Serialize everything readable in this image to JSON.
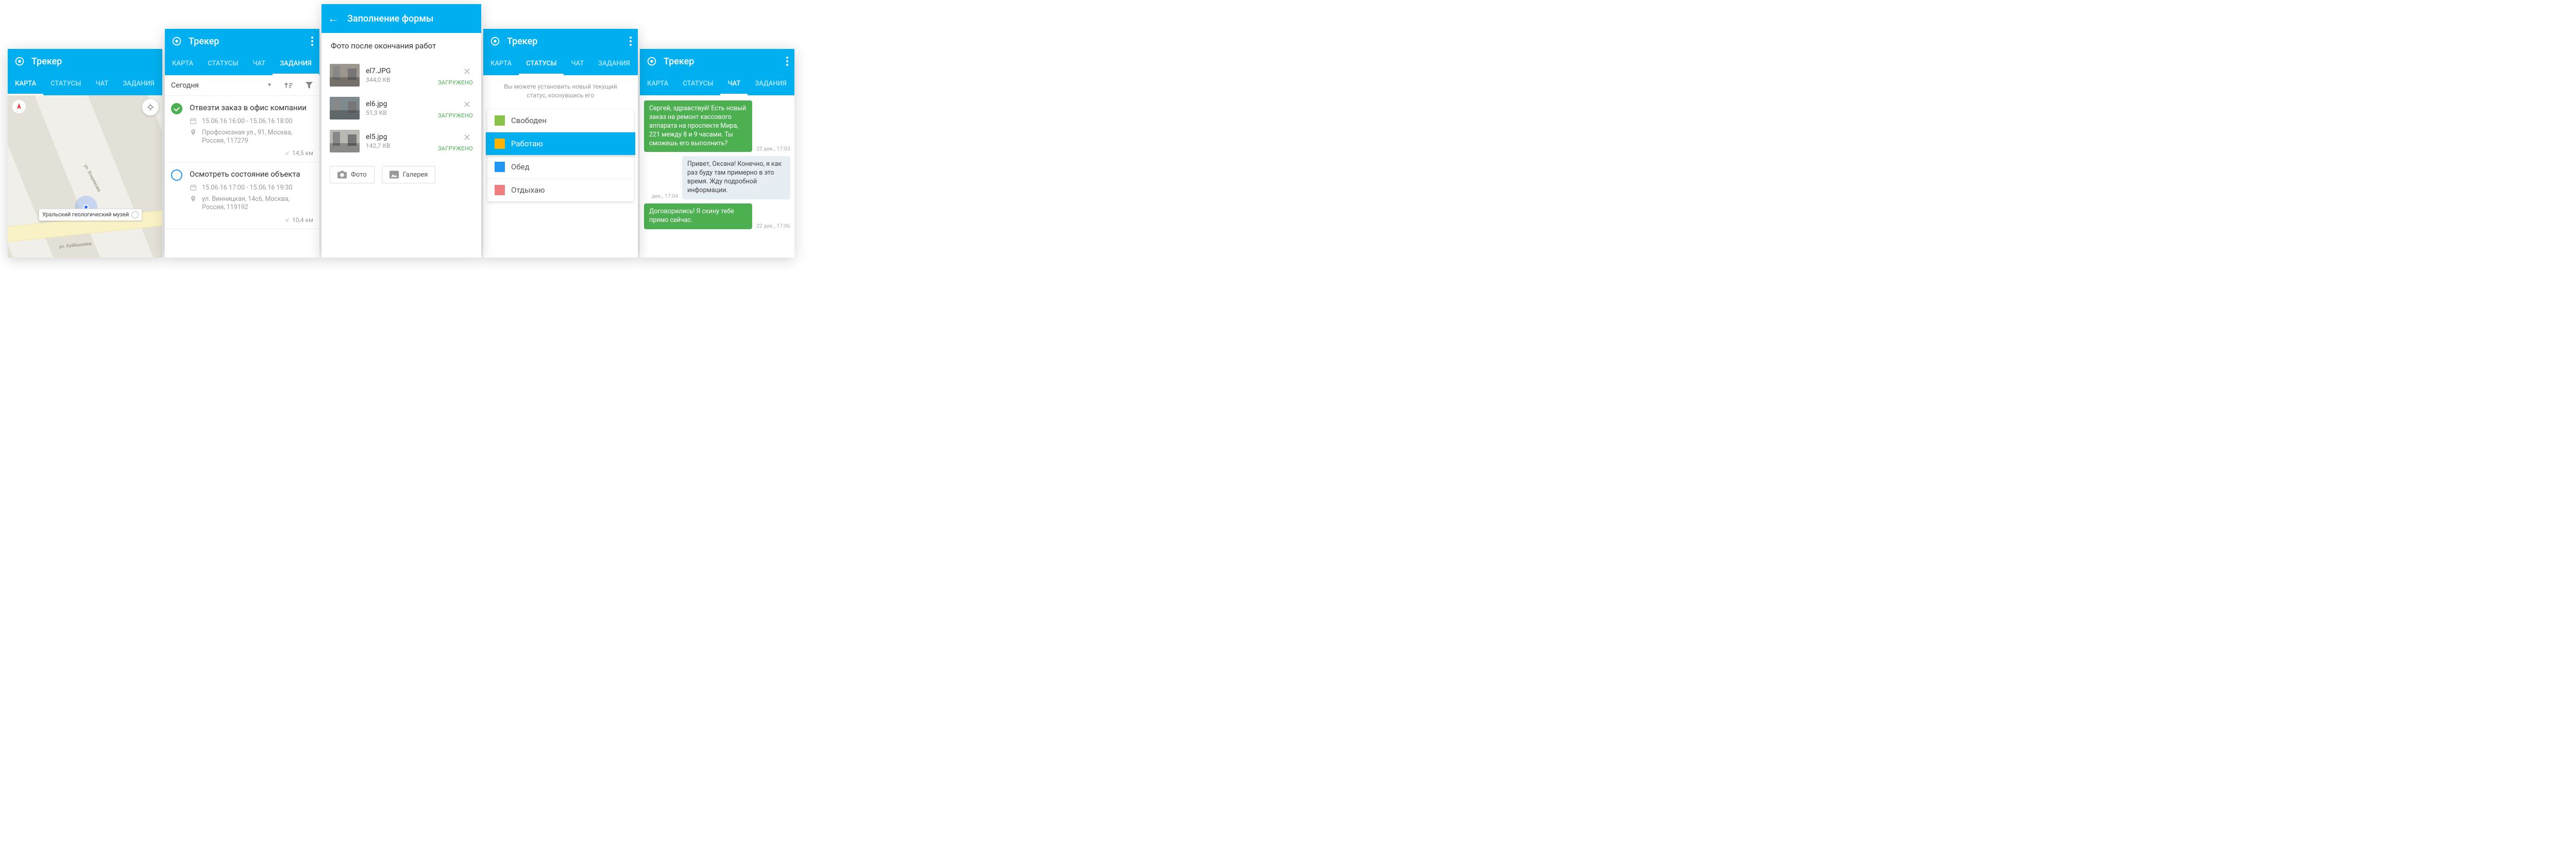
{
  "app": {
    "title": "Трекер"
  },
  "tabs": {
    "map": "КАРТА",
    "statuses": "СТАТУСЫ",
    "chat": "ЧАТ",
    "tasks": "ЗАДАНИЯ"
  },
  "map": {
    "poi_name": "Уральский геологический музей",
    "street1": "ул. Хохрякова",
    "street2": "ул. Куйбышева"
  },
  "tasksScreen": {
    "filter": "Сегодня",
    "items": [
      {
        "title": "Отвезти заказ в офис компании",
        "time": "15.06.16 16:00 - 15.06.16 18:00",
        "addr": "Профсоюзная ул., 91, Москва, Россия, 117279",
        "dist": "14,5 км"
      },
      {
        "title": "Осмотреть состояние объекта",
        "time": "15.06.16 17:00 - 15.06.16 19:30",
        "addr": "ул. Винницкая, 14с6, Москва, Россия, 119192",
        "dist": "10,4 км"
      }
    ]
  },
  "form": {
    "header": "Заполнение формы",
    "section": "Фото после окончания работ",
    "uploaded": "ЗАГРУЖЕНО",
    "files": [
      {
        "name": "el7.JPG",
        "size": "344,0 КВ"
      },
      {
        "name": "el6.jpg",
        "size": "51,3 КВ"
      },
      {
        "name": "el5.jpg",
        "size": "142,7 КВ"
      }
    ],
    "btn_photo": "Фото",
    "btn_gallery": "Галерея"
  },
  "statuses": {
    "hint": "Вы можете установить новый текущий статус, коснувшись его",
    "items": [
      {
        "label": "Свободен",
        "color": "#8bc34a"
      },
      {
        "label": "Работаю",
        "color": "#ffb300"
      },
      {
        "label": "Обед",
        "color": "#2196f3"
      },
      {
        "label": "Отдыхаю",
        "color": "#ef7e7e"
      }
    ]
  },
  "chat": [
    {
      "dir": "in",
      "text": "Сергей, здравствуй! Есть новый заказ на ремонт кассового аппарата на проспекте Мира, 221 между 8 и 9 часами. Ты сможешь его выполнить?",
      "time": "22 дек., 17:03"
    },
    {
      "dir": "out",
      "text": "Привет, Оксана! Конечно, я как раз буду там примерно в это время. Жду подробной информации.",
      "time": "дек., 17:04"
    },
    {
      "dir": "in",
      "text": "Договорились! Я скину тебе прямо сейчас.",
      "time": "22 дек., 17:06"
    }
  ]
}
